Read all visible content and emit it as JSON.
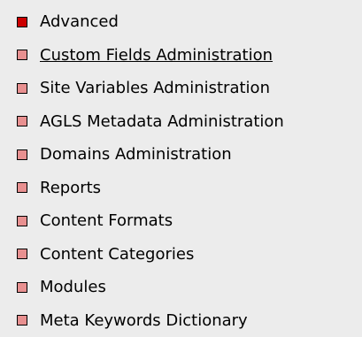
{
  "colors": {
    "background": "#ececec",
    "bullet_active": "#cc0000",
    "bullet_normal": "#e89090",
    "bullet_border": "#000000",
    "text": "#000000"
  },
  "menu": {
    "items": [
      {
        "label": "Advanced",
        "bullet": "active",
        "underline": false
      },
      {
        "label": "Custom Fields Administration",
        "bullet": "normal",
        "underline": true
      },
      {
        "label": "Site Variables Administration",
        "bullet": "normal",
        "underline": false
      },
      {
        "label": "AGLS Metadata Administration",
        "bullet": "normal",
        "underline": false
      },
      {
        "label": "Domains Administration",
        "bullet": "normal",
        "underline": false
      },
      {
        "label": "Reports",
        "bullet": "normal",
        "underline": false
      },
      {
        "label": "Content Formats",
        "bullet": "normal",
        "underline": false
      },
      {
        "label": "Content Categories",
        "bullet": "normal",
        "underline": false
      },
      {
        "label": "Modules",
        "bullet": "normal",
        "underline": false
      },
      {
        "label": "Meta Keywords Dictionary",
        "bullet": "normal",
        "underline": false
      }
    ]
  }
}
